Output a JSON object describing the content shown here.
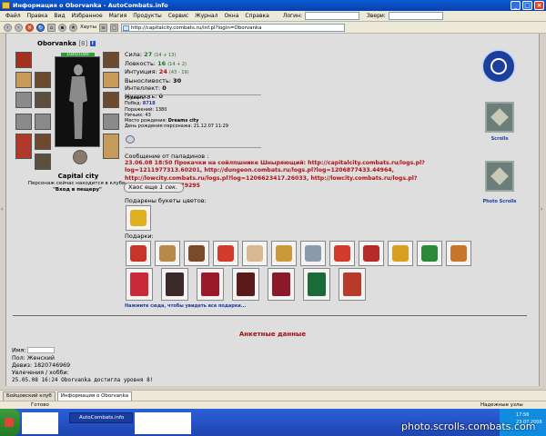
{
  "window": {
    "title": "Информация о Oborvanka - AutoCombats.info"
  },
  "menu": {
    "items": [
      "Файл",
      "Правка",
      "Вид",
      "Избранное",
      "Магия",
      "Продукты",
      "Сервис",
      "Журнал",
      "Окна",
      "Справка"
    ],
    "login_label": "Логин:",
    "zvery_label": "Звери:"
  },
  "toolbar": {
    "favorites_label": "Хауты",
    "address": "http://capitalcity.combats.ru/inf.pl?login=Oborvanka"
  },
  "character": {
    "name": "Oborvanka",
    "level": "[8]",
    "hp": "1040/1040",
    "city": "Capital city",
    "location_line1": "Персонаж сейчас находится в клубе.",
    "location_line2": "\"Вход в пещеру\""
  },
  "stats": [
    {
      "label": "Сила:",
      "value": "27",
      "extra": "(14 + 13)",
      "color": "green"
    },
    {
      "label": "Ловкость:",
      "value": "16",
      "extra": "(14 + 2)",
      "color": "green"
    },
    {
      "label": "Интуиция:",
      "value": "24",
      "extra": "(43 - 19)",
      "color": "red"
    },
    {
      "label": "Выносливость:",
      "value": "30",
      "extra": "",
      "color": "plain"
    },
    {
      "label": "Интеллект:",
      "value": "0",
      "extra": "",
      "color": "plain"
    },
    {
      "label": "Мудрость:",
      "value": "0",
      "extra": "",
      "color": "plain"
    }
  ],
  "info": [
    {
      "label": "Уровень:",
      "value": "8"
    },
    {
      "label": "Побед:",
      "value": "8718"
    },
    {
      "label": "Поражений:",
      "value": "1380"
    },
    {
      "label": "Ничьих:",
      "value": "43"
    },
    {
      "label": "Место рождения:",
      "value": "Dreams city"
    },
    {
      "label": "День рождения персонажа:",
      "value": "21.12.07 11:29"
    }
  ],
  "message": {
    "title": "Сообщение от паладинов :",
    "body": "23.06.08 18:50 Прокачки на сойлпшнике Шныряющий: http://capitalcity.combats.ru/logs.pl?log=1211977313.60201, http://dungeon.combats.ru/logs.pl?log=1206877433.44964, http://lowcity.combats.ru/logs.pl?log=1206623417.26033, http://lowcity.combats.ru/logs.pl?log=1205783152.79295"
  },
  "chaos": {
    "prefix": "Хаос еще",
    "value": "1 сек."
  },
  "flowers_title": "Подарены букеты цветов:",
  "gifts_title": "Подарки:",
  "gifts_more": "Нажмите сюда, чтобы увидеть все подарки...",
  "profile": {
    "title": "Анкетные данные",
    "name_label": "Имя:",
    "gender": "Пол: Женский",
    "motto": "Девиз: 1820746969",
    "hobby_label": "Увлечения / хобби:",
    "hobby_text": "25.05.08 16:24 Oborvanka достигла уровня 8!"
  },
  "right_panel": {
    "scrolls_label": "Scrolls",
    "photo_label": "Photo Scrolls"
  },
  "tabs": [
    "Бойцовский клуб",
    "Информация о Oborvanka"
  ],
  "status": {
    "left": "Готово",
    "right": "Надежные узлы"
  },
  "taskbar": {
    "task": "AutoCombats.info",
    "clock": "17:56",
    "date": "23.07.2008"
  },
  "watermark": "photo.scrolls.combats.com"
}
